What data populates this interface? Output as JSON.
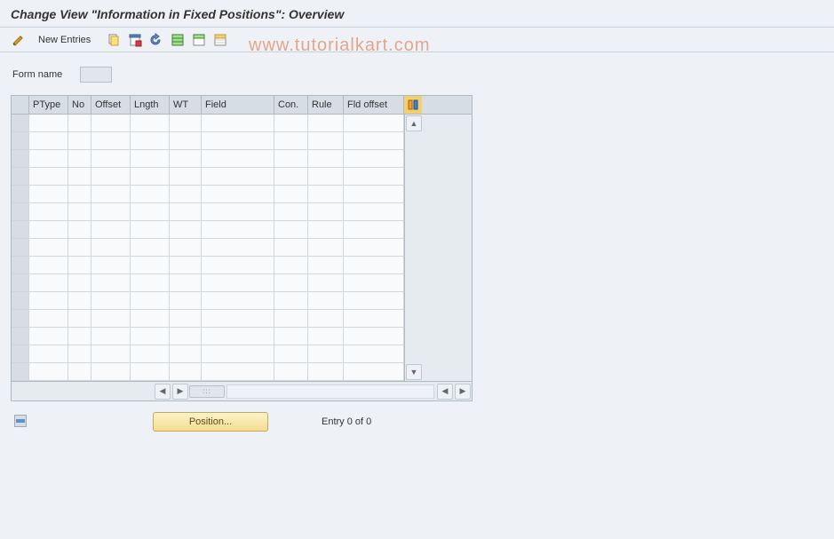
{
  "title": "Change View \"Information in Fixed Positions\": Overview",
  "toolbar": {
    "new_entries_label": "New Entries"
  },
  "watermark": "www.tutorialkart.com",
  "form": {
    "name_label": "Form name",
    "name_value": ""
  },
  "table": {
    "columns": [
      "PType",
      "No",
      "Offset",
      "Lngth",
      "WT",
      "Field",
      "Con.",
      "Rule",
      "Fld offset"
    ],
    "rows": [],
    "visible_row_count": 15
  },
  "footer": {
    "position_label": "Position...",
    "entry_text": "Entry 0 of 0"
  }
}
